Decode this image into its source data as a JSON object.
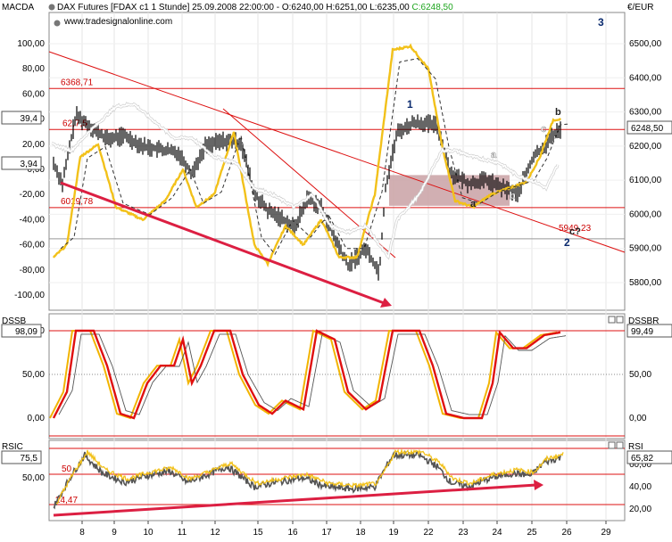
{
  "header": {
    "indicator_top_left": "MACDA",
    "title_prefix": "DAX Futures [FDAX c1  1 Stunde] 25.09.2008 22:00:00 - ",
    "ohlc": "O:6240,00 H:6251,00 L:6235,00 ",
    "close": "C:6248,50",
    "website": "www.tradesignalonline.com",
    "currency": "€/EUR",
    "wave_count_top": "3"
  },
  "panels": {
    "main": {
      "left_axis_ticks": [
        "100,00",
        "80,00",
        "60,00",
        "40,00",
        "20,00",
        "0,00",
        "-20,00",
        "-40,00",
        "-60,00",
        "-80,00",
        "-100,00"
      ],
      "right_axis_ticks": [
        "6500,00",
        "6400,00",
        "6300,00",
        "6200,00",
        "6100,00",
        "6000,00",
        "5900,00",
        "5800,00"
      ],
      "left_value_box_1": "39,4",
      "left_value_box_2": "3,94",
      "right_price_box": "6248,50",
      "levels": [
        {
          "label": "6368,71",
          "price": 6368.71
        },
        {
          "label": "62,7,5",
          "price": 6248.5
        },
        {
          "label": "6019,78",
          "price": 6019.78
        },
        {
          "label": "5949,23",
          "price": 5949.23
        }
      ],
      "wave_labels": [
        {
          "text": "1",
          "kind": "blue"
        },
        {
          "text": "2",
          "kind": "blue"
        },
        {
          "text": "a",
          "kind": "dark"
        },
        {
          "text": "a",
          "kind": "white"
        },
        {
          "text": "b",
          "kind": "white"
        },
        {
          "text": "c",
          "kind": "white"
        },
        {
          "text": "b",
          "kind": "dark"
        },
        {
          "text": "c?",
          "kind": "dark"
        }
      ]
    },
    "dssb": {
      "left_title": "DSSB",
      "right_title": "DSSBR",
      "left_value_box": "98,09",
      "right_value_box": "99,49",
      "right_axis_ticks": [
        "100,00",
        "50,00",
        "0,00"
      ],
      "left_axis_ticks": [
        "100,00",
        "50,00",
        "0,00"
      ]
    },
    "rsi": {
      "left_title": "RSIC",
      "right_title": "RSI",
      "left_value_box": "75,5",
      "right_value_box": "65,82",
      "left_axis_ticks": [
        "50,00"
      ],
      "right_axis_ticks": [
        "60,00",
        "40,00",
        "20,00"
      ],
      "level_labels": [
        "50",
        "24,47"
      ]
    }
  },
  "x_axis": {
    "ticks": [
      "8",
      "9",
      "10",
      "11",
      "12",
      "15",
      "16",
      "17",
      "18",
      "19",
      "22",
      "23",
      "24",
      "25",
      "26",
      "29"
    ]
  },
  "colors": {
    "background": "#ffffff",
    "price": "#000000",
    "macd_yellow": "#f2c11a",
    "signal_white": "#ffffff",
    "red_line": "#dd1111",
    "trend_arrow": "#dc1f42",
    "zone_fill": "#c9a1a5",
    "wave_blue": "#0a2a6e"
  },
  "chart_data": [
    {
      "type": "line",
      "title": "DAX Futures [FDAX c1  1 Stunde]",
      "x": [
        "8",
        "9",
        "10",
        "11",
        "12",
        "15",
        "16",
        "17",
        "18",
        "19",
        "22",
        "23",
        "24",
        "25",
        "26",
        "29"
      ],
      "ylim_price": [
        5750,
        6560
      ],
      "ylim_macd": [
        -110,
        110
      ],
      "series": [
        {
          "name": "",
          "values": [
            6120,
            6270,
            6230,
            6190,
            6220,
            6030,
            6020,
            5960,
            5830,
            6200,
            6240,
            6090,
            6070,
            6120,
            6248.5,
            null
          ]
        },
        {
          "name": "MACDA",
          "values": [
            -70,
            10,
            -30,
            -20,
            -15,
            -60,
            -40,
            -35,
            -45,
            95,
            60,
            -25,
            -20,
            10,
            39.4,
            null
          ]
        },
        {
          "name": "",
          "values": [
            15,
            45,
            30,
            25,
            10,
            -20,
            -30,
            -40,
            -60,
            -30,
            20,
            25,
            15,
            5,
            3.94,
            null
          ]
        }
      ]
    },
    {
      "type": "line",
      "title": "DSSB",
      "x": [
        "8",
        "9",
        "10",
        "11",
        "12",
        "15",
        "16",
        "17",
        "18",
        "19",
        "22",
        "23",
        "24",
        "25",
        "26",
        "29"
      ],
      "ylim": [
        -25,
        125
      ],
      "series": [
        {
          "name": "DSSB",
          "values": [
            10,
            98,
            20,
            80,
            100,
            10,
            98,
            5,
            100,
            10,
            100,
            10,
            5,
            90,
            98.09,
            null
          ]
        },
        {
          "name": "DSSBR",
          "values": [
            5,
            95,
            15,
            70,
            98,
            12,
            95,
            8,
            98,
            20,
            98,
            15,
            10,
            85,
            99.49,
            null
          ]
        }
      ]
    },
    {
      "type": "line",
      "title": "RSIC",
      "x": [
        "8",
        "9",
        "10",
        "11",
        "12",
        "15",
        "16",
        "17",
        "18",
        "19",
        "22",
        "23",
        "24",
        "25",
        "26",
        "29"
      ],
      "ylim": [
        10,
        80
      ],
      "series": [
        {
          "name": "RSIC",
          "values": [
            22,
            68,
            44,
            56,
            62,
            40,
            45,
            40,
            38,
            68,
            60,
            42,
            44,
            55,
            75.5,
            null
          ]
        },
        {
          "name": "RSI",
          "values": [
            24,
            62,
            46,
            52,
            58,
            40,
            44,
            42,
            40,
            66,
            60,
            38,
            40,
            50,
            65.82,
            null
          ]
        }
      ]
    }
  ]
}
